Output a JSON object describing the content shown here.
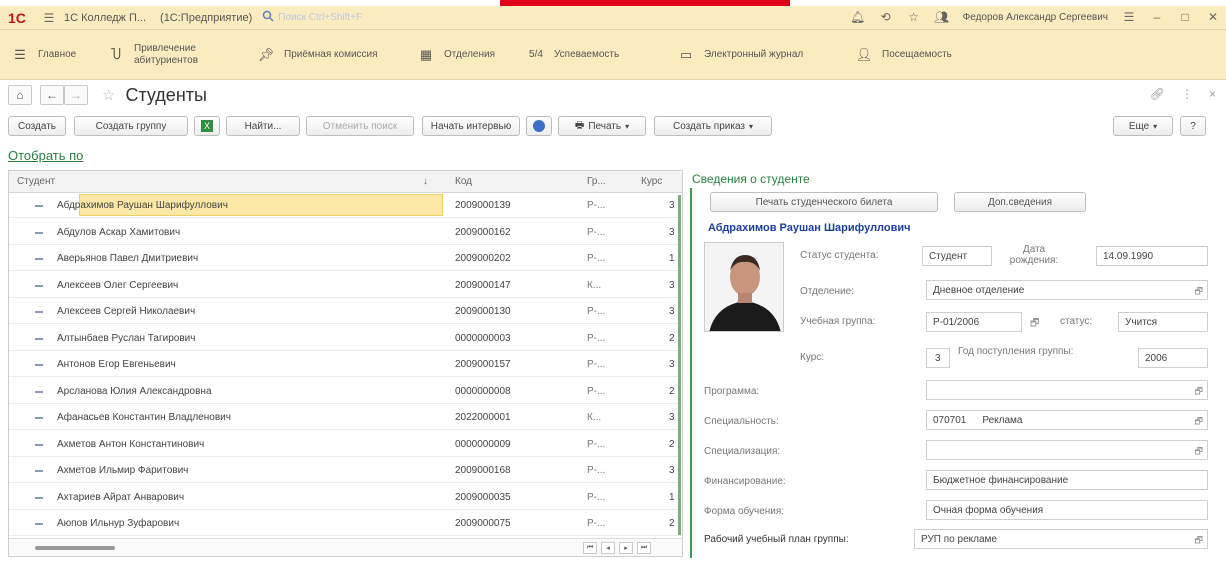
{
  "titlebar": {
    "app_name": "1С Колледж П...",
    "app_mode": "(1С:Предприятие)",
    "search_placeholder": "Поиск Ctrl+Shift+F",
    "user": "Федоров Александр Сергеевич",
    "logo": "1С"
  },
  "sections": [
    {
      "label": "Главное",
      "icon": "menu-icon"
    },
    {
      "label": "Привлечение абитуриентов",
      "icon": "magnet-icon"
    },
    {
      "label": "Приёмная комиссия",
      "icon": "pin-icon"
    },
    {
      "label": "Отделения",
      "icon": "building-icon"
    },
    {
      "label": "Успеваемость",
      "icon": "grade-icon"
    },
    {
      "label": "Электронный журнал",
      "icon": "journal-icon"
    },
    {
      "label": "Посещаемость",
      "icon": "attendance-icon"
    }
  ],
  "form": {
    "title": "Студенты"
  },
  "toolbar": {
    "create": "Создать",
    "create_group": "Создать группу",
    "find": "Найти...",
    "cancel_search": "Отменить поиск",
    "start_interview": "Начать интервью",
    "print": "Печать",
    "create_order": "Создать приказ",
    "more": "Еще",
    "help": "?"
  },
  "filter_link": "Отобрать по",
  "table": {
    "headers": {
      "student": "Студент",
      "code": "Код",
      "group": "Гр...",
      "course": "Курс"
    },
    "rows": [
      {
        "name": "Абдрахимов Раушан Шарифуллович",
        "code": "2009000139",
        "group": "Р-...",
        "course": "3"
      },
      {
        "name": "Абдулов Аскар Хамитович",
        "code": "2009000162",
        "group": "Р-...",
        "course": "3"
      },
      {
        "name": "Аверьянов Павел Дмитриевич",
        "code": "2009000202",
        "group": "Р-...",
        "course": "1"
      },
      {
        "name": "Алексеев Олег Сергеевич",
        "code": "2009000147",
        "group": "К...",
        "course": "3"
      },
      {
        "name": "Алексеев Сергей Николаевич",
        "code": "2009000130",
        "group": "Р-...",
        "course": "3"
      },
      {
        "name": "Алтынбаев Руслан Тагирович",
        "code": "0000000003",
        "group": "Р-...",
        "course": "2"
      },
      {
        "name": "Антонов Егор Евгеньевич",
        "code": "2009000157",
        "group": "Р-...",
        "course": "3"
      },
      {
        "name": "Арсланова Юлия Александровна",
        "code": "0000000008",
        "group": "Р-...",
        "course": "2"
      },
      {
        "name": "Афанасьев Константин Владленович",
        "code": "2022000001",
        "group": "К...",
        "course": "3"
      },
      {
        "name": "Ахметов Антон Константинович",
        "code": "0000000009",
        "group": "Р-...",
        "course": "2"
      },
      {
        "name": "Ахметов Ильмир Фаритович",
        "code": "2009000168",
        "group": "Р-...",
        "course": "3"
      },
      {
        "name": "Ахтариев Айрат Анварович",
        "code": "2009000035",
        "group": "Р-...",
        "course": "1"
      },
      {
        "name": "Аюпов Ильнур Зуфарович",
        "code": "2009000075",
        "group": "Р-...",
        "course": "2"
      }
    ]
  },
  "panel": {
    "title": "Сведения о студенте",
    "print_card": "Печать студенческого билета",
    "more_info": "Доп.сведения",
    "student_name": "Абдрахимов Раушан Шарифуллович",
    "status_label": "Статус студента:",
    "status_value": "Студент",
    "dob_label": "Дата рождения:",
    "dob_value": "14.09.1990",
    "dept_label": "Отделение:",
    "dept_value": "Дневное отделение",
    "group_label": "Учебная группа:",
    "group_value": "Р-01/2006",
    "gstatus_label": "статус:",
    "gstatus_value": "Учится",
    "course_label": "Курс:",
    "course_value": "3",
    "year_label": "Год поступления группы:",
    "year_value": "2006",
    "program_label": "Программа:",
    "program_value": "",
    "spec_label": "Специальность:",
    "spec_code": "070701",
    "spec_value": "Реклама",
    "specialization_label": "Специализация:",
    "specialization_value": "",
    "finance_label": "Финансирование:",
    "finance_value": "Бюджетное финансирование",
    "form_label": "Форма обучения:",
    "form_value": "Очная форма обучения",
    "plan_label": "Рабочий учебный план группы:",
    "plan_value": "РУП по рекламе"
  }
}
